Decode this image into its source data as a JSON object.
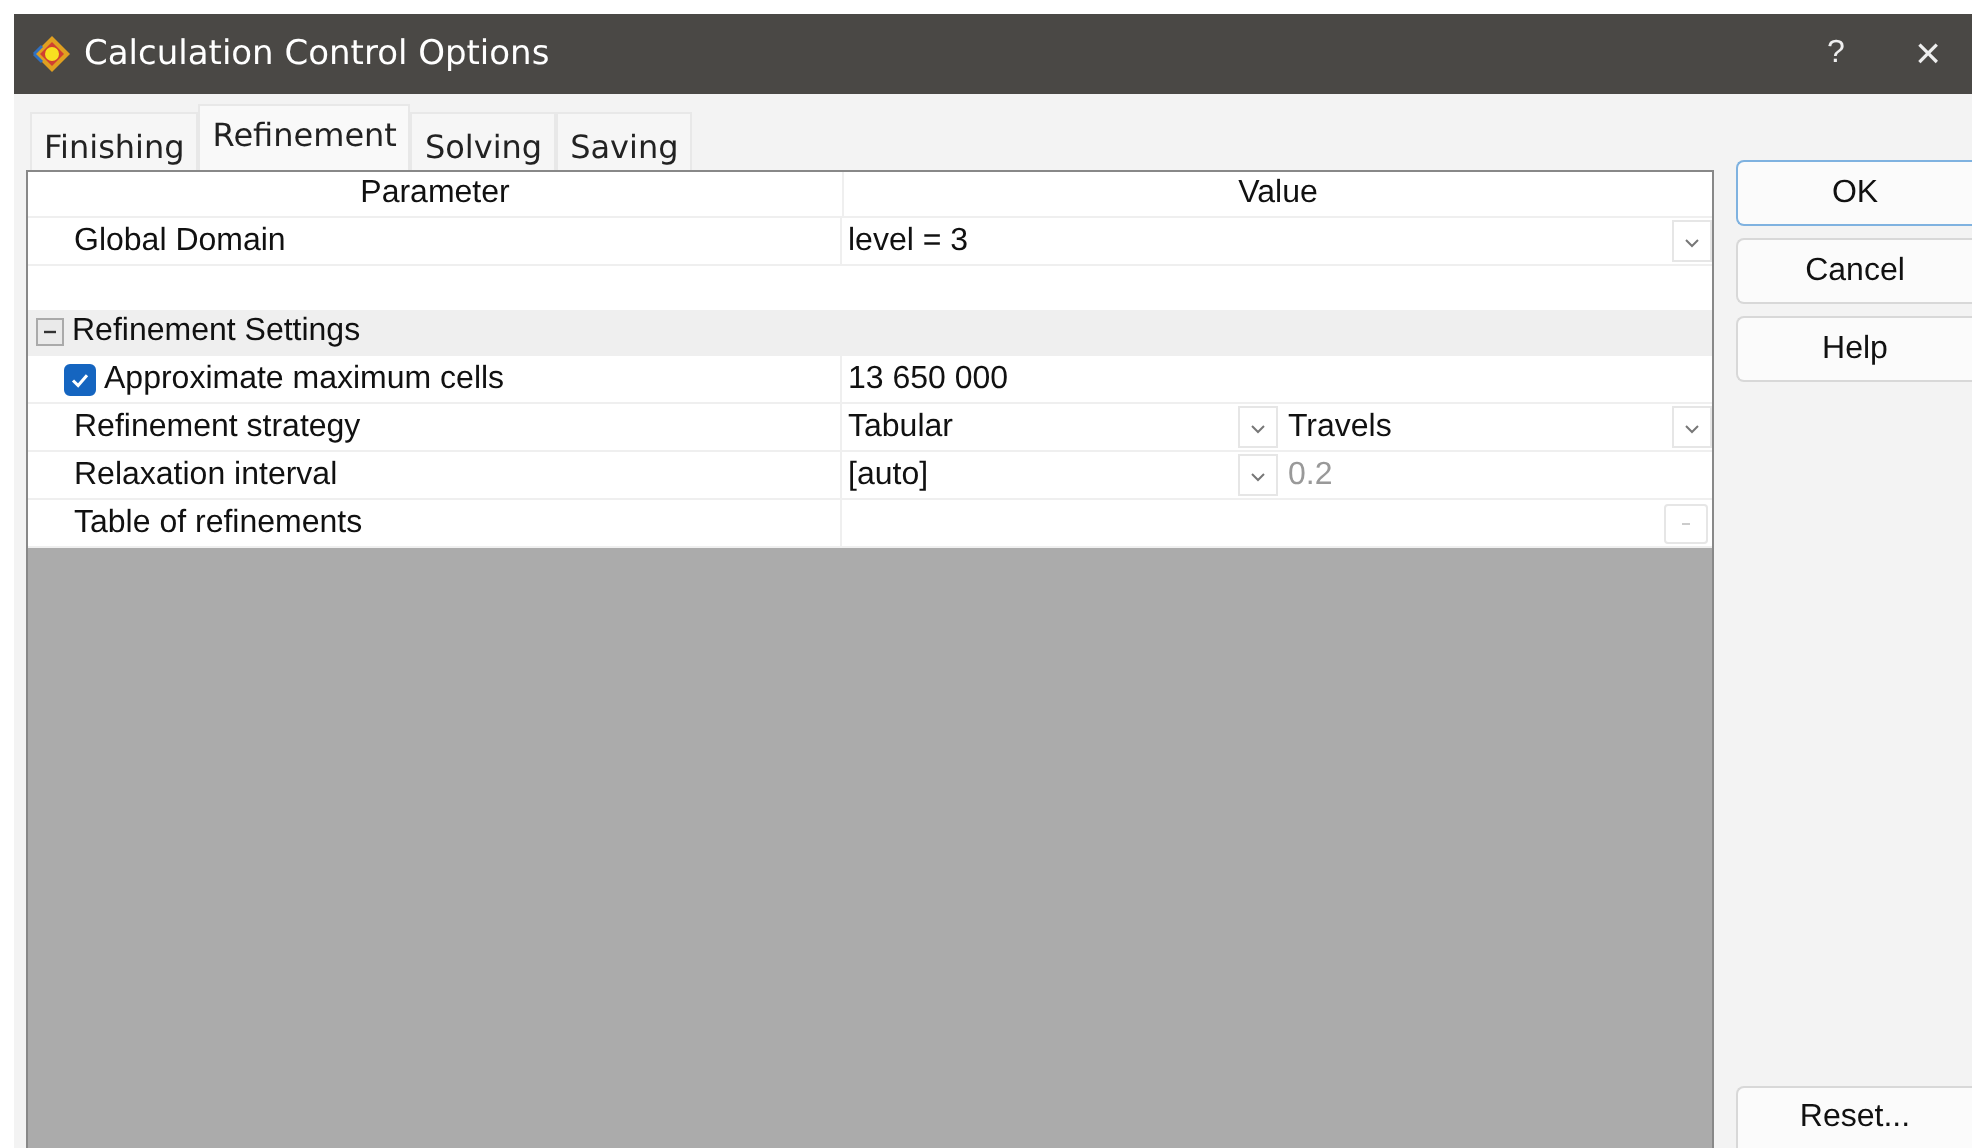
{
  "window": {
    "title": "Calculation Control Options",
    "help": "?",
    "close": "×"
  },
  "tabs": [
    {
      "label": "Finishing",
      "selected": false
    },
    {
      "label": "Refinement",
      "selected": true
    },
    {
      "label": "Solving",
      "selected": false
    },
    {
      "label": "Saving",
      "selected": false
    }
  ],
  "table": {
    "columns": [
      "Parameter",
      "Value"
    ],
    "rows": [
      {
        "kind": "combo",
        "name": "Global Domain",
        "value": "level = 3"
      },
      {
        "kind": "blank"
      },
      {
        "kind": "group",
        "name": "Refinement Settings",
        "expanded": true
      },
      {
        "kind": "check",
        "name": "Approximate maximum cells",
        "checked": true,
        "value": "13 650 000"
      },
      {
        "kind": "split",
        "name": "Refinement strategy",
        "value": "Tabular",
        "value_2": "Travels",
        "disabled": false
      },
      {
        "kind": "split",
        "name": "Relaxation interval",
        "value": "[auto]",
        "value_2": "0.2",
        "disabled": true
      },
      {
        "kind": "button",
        "name": "Table of refinements"
      }
    ]
  },
  "buttons": [
    "OK",
    "Cancel",
    "Help"
  ],
  "reset_button": "Reset..."
}
